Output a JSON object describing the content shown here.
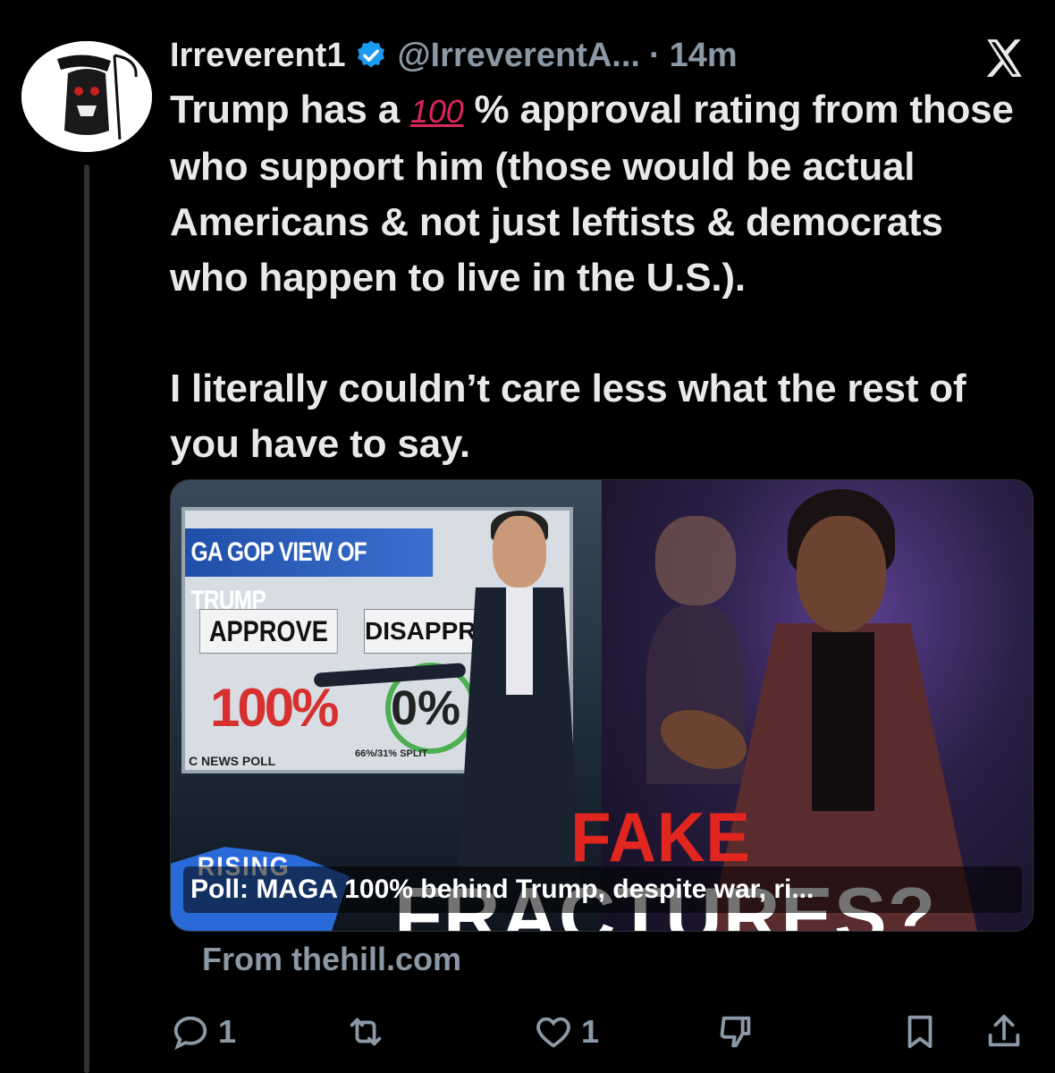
{
  "author": {
    "display_name": "Irreverent1",
    "handle": "@IrreverentA...",
    "separator": "·",
    "time": "14m"
  },
  "tweet": {
    "para1_before": "Trump has a ",
    "para1_emoji": "100",
    "para1_after": " % approval rating from those who support him (those would be actual Americans & not just leftists & democrats who happen to live in the U.S.).",
    "para2": "I literally couldn’t care less what the rest of you have to say."
  },
  "card": {
    "screen_title": "GA GOP VIEW OF TRUMP",
    "approve_label": "APPROVE",
    "disapprove_label": "DISAPPRO",
    "approve_value": "100%",
    "disapprove_value": "0%",
    "poll_source": "C NEWS POLL",
    "poll_split": "66%/31% SPLIT",
    "rising": "RISING",
    "fake": "FAKE",
    "fractures": "FRACTURES?",
    "caption": "Poll: MAGA 100% behind Trump, despite war, ri...",
    "source": "From thehill.com"
  },
  "actions": {
    "replies": "1",
    "reposts": "",
    "likes": "1"
  }
}
